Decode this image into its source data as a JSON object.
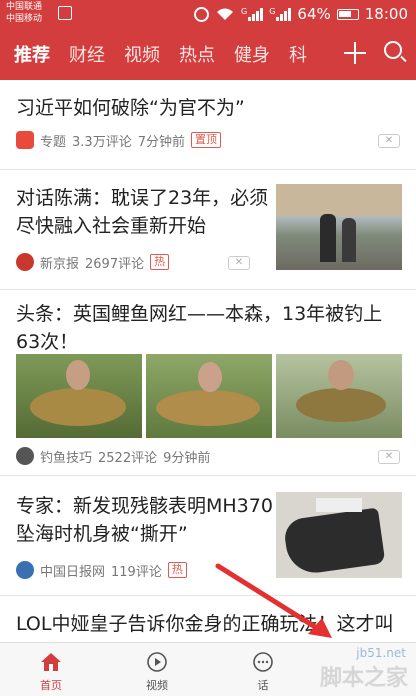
{
  "status_bar": {
    "carrier_1": "中国联通",
    "carrier_2": "中国移动",
    "signal_1": "G",
    "signal_2": "G",
    "battery": "64%",
    "time": "18:00"
  },
  "channels": {
    "tabs": [
      "推荐",
      "财经",
      "视频",
      "热点",
      "健身",
      "科"
    ],
    "active_index": 0
  },
  "feed": [
    {
      "title": "习近平如何破除“为官不为”",
      "source": "专题",
      "comments": "3.3万评论",
      "time": "7分钟前",
      "tag": "置顶"
    },
    {
      "title": "对话陈满：耽误了23年，必须尽快融入社会重新开始",
      "source": "新京报",
      "comments": "2697评论",
      "time": "",
      "tag": "热"
    },
    {
      "title": "头条：英国鲤鱼网红——本森，13年被钓上63次！",
      "source": "钓鱼技巧",
      "comments": "2522评论",
      "time": "9分钟前",
      "tag": ""
    },
    {
      "title": "专家：新发现残骸表明MH370坠海时机身被“撕开”",
      "source": "中国日报网",
      "comments": "119评论",
      "time": "",
      "tag": "热"
    },
    {
      "title": "LOL中娅皇子告诉你金身的正确玩法！这才叫游戏",
      "source": "",
      "comments": "",
      "time": "",
      "tag": ""
    }
  ],
  "close_glyph": "✕",
  "bottom_nav": [
    {
      "label": "首页",
      "icon": "home-icon"
    },
    {
      "label": "视频",
      "icon": "play-icon"
    },
    {
      "label": "话",
      "icon": "chat-icon"
    }
  ],
  "watermark": {
    "main": "脚本之家",
    "url": "jb51.net"
  },
  "colors": {
    "brand": "#d43d3d",
    "tag": "#e05a4f"
  }
}
